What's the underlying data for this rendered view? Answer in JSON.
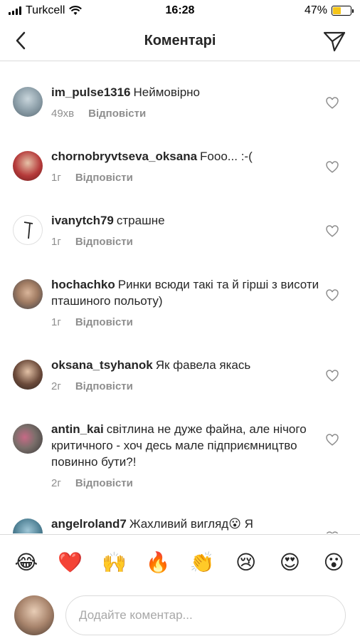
{
  "status_bar": {
    "carrier": "Turkcell",
    "time": "16:28",
    "battery": "47%",
    "battery_level": 0.47
  },
  "header": {
    "title": "Коментарі",
    "back_icon": "chevron-left-icon",
    "send_icon": "paper-plane-icon"
  },
  "comments": [
    {
      "username": "im_pulse1316",
      "text": "Неймовірно",
      "time": "49хв",
      "reply": "Відповісти"
    },
    {
      "username": "chornobryvtseva_oksana",
      "text": "Fooo... :-(",
      "time": "1г",
      "reply": "Відповісти"
    },
    {
      "username": "ivanytch79",
      "text": "страшне",
      "time": "1г",
      "reply": "Відповісти"
    },
    {
      "username": "hochachko",
      "text": "Ринки всюди такі та й гірші з висоти пташиного польоту)",
      "time": "1г",
      "reply": "Відповісти"
    },
    {
      "username": "oksana_tsyhanok",
      "text": "Як фавела якась",
      "time": "2г",
      "reply": "Відповісти"
    },
    {
      "username": "antin_kai",
      "text": "світлина не дуже файна, але нічого критичного - хоч десь мале підприємництво повинно бути?!",
      "time": "2г",
      "reply": "Відповісти"
    },
    {
      "username": "angelroland7",
      "text": "Жахливий вигляд😮 Я",
      "time": "",
      "reply": ""
    }
  ],
  "emoji_bar": [
    "😂",
    "❤️",
    "🙌",
    "🔥",
    "👏",
    "😢",
    "😍",
    "😮"
  ],
  "composer": {
    "placeholder": "Додайте коментар..."
  },
  "colors": {
    "text": "#262626",
    "secondary": "#8e8e8e",
    "divider": "#dbdbdb",
    "battery_fill": "#f5c518"
  }
}
